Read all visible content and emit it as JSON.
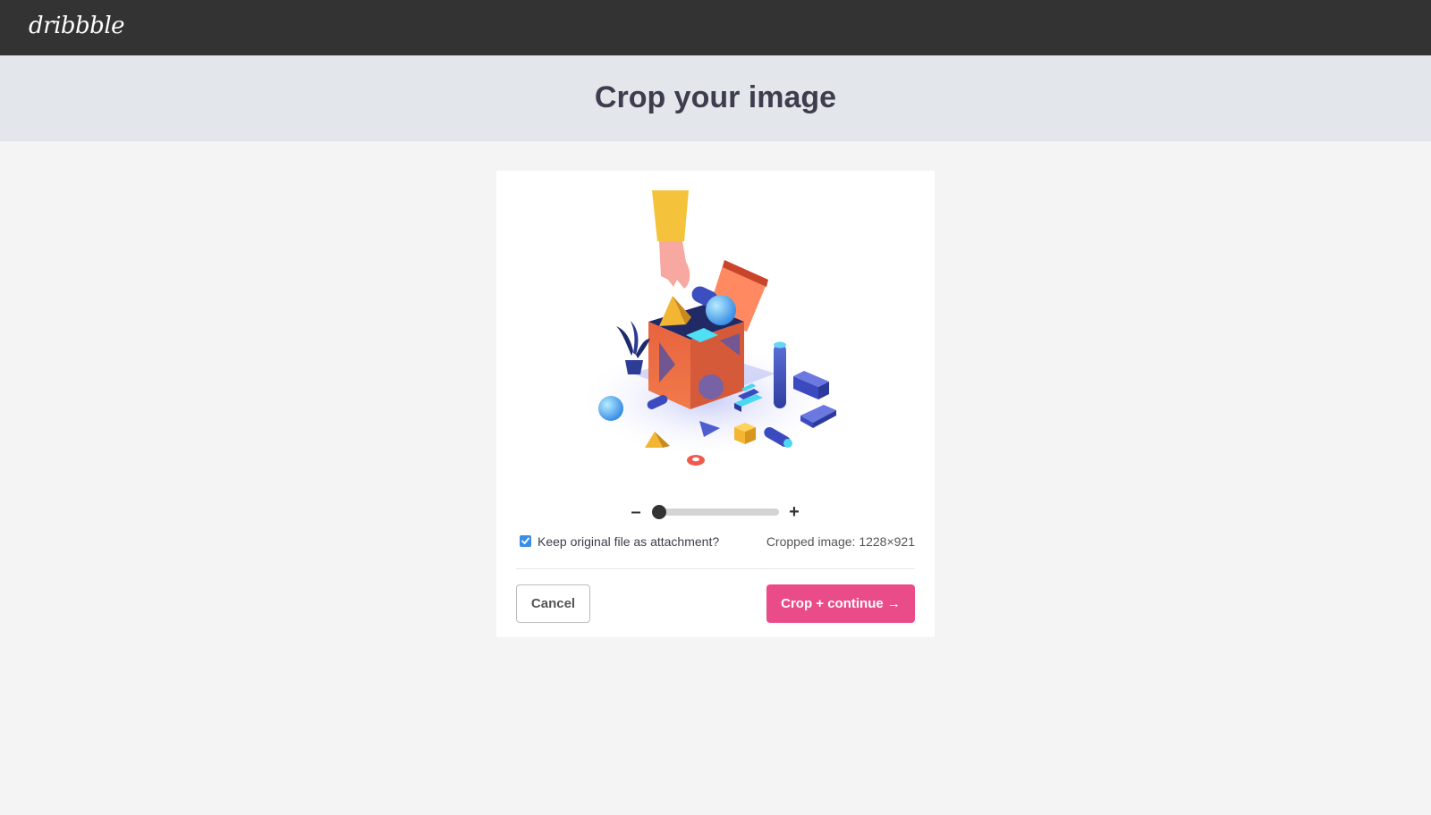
{
  "header": {
    "logo": "dribbble"
  },
  "page": {
    "title": "Crop your image"
  },
  "crop": {
    "zoom_minus": "–",
    "zoom_plus": "+",
    "zoom_level": 0,
    "keep_original_label": "Keep original file as attachment?",
    "keep_original_checked": true,
    "cropped_info": "Cropped image: 1228×921"
  },
  "actions": {
    "cancel_label": "Cancel",
    "crop_label": "Crop + continue →"
  },
  "colors": {
    "topbar": "#333333",
    "accent": "#ea4c89",
    "checkbox": "#3a8ee6"
  },
  "illustration": {
    "icon": "open-box-with-geometric-shapes-illustration"
  }
}
